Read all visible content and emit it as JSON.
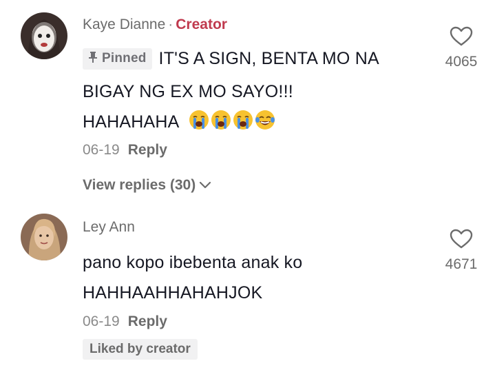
{
  "comments": [
    {
      "author": "Kaye Dianne",
      "separator": "·",
      "author_badge": "Creator",
      "pinned_label": "Pinned",
      "text_line_1": "IT'S A SIGN, BENTA MO NA",
      "text_line_2": "BIGAY NG EX MO SAYO!!!",
      "text_line_3": "HAHAHAHA",
      "emojis": [
        "crying-face-icon",
        "crying-face-icon",
        "crying-face-icon",
        "tears-of-joy-icon"
      ],
      "date": "06-19",
      "reply_label": "Reply",
      "view_replies": "View replies (30)",
      "like_count": "4065"
    },
    {
      "author": "Ley Ann",
      "text_line_1": "pano kopo ibebenta anak ko",
      "text_line_2": "HAHHAAHHAHAHJOK",
      "date": "06-19",
      "reply_label": "Reply",
      "liked_by_creator": "Liked by creator",
      "like_count": "4671"
    }
  ],
  "colors": {
    "creator_badge": "#c03a4e",
    "secondary_text": "#8a8a8a",
    "primary_text": "#161823"
  }
}
